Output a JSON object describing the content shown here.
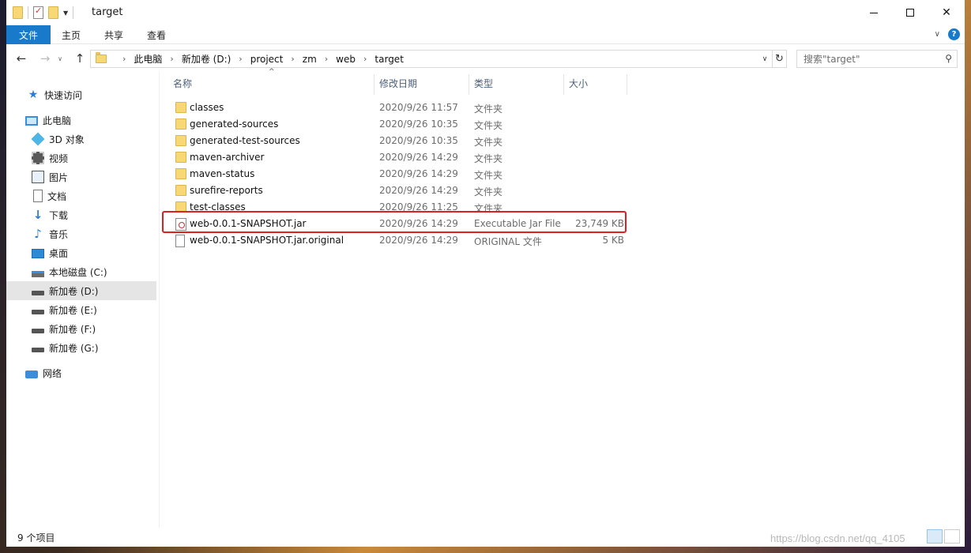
{
  "window": {
    "title": "target"
  },
  "ribbon": {
    "tabs": [
      "文件",
      "主页",
      "共享",
      "查看"
    ]
  },
  "address": {
    "crumbs": [
      "此电脑",
      "新加卷 (D:)",
      "project",
      "zm",
      "web",
      "target"
    ]
  },
  "search": {
    "placeholder": "搜索\"target\""
  },
  "sidebar": {
    "items": [
      {
        "label": "快速访问",
        "icon": "star-icon"
      },
      {
        "label": "此电脑",
        "icon": "computer-icon"
      },
      {
        "label": "3D 对象",
        "icon": "cube-icon"
      },
      {
        "label": "视频",
        "icon": "video-icon"
      },
      {
        "label": "图片",
        "icon": "picture-icon"
      },
      {
        "label": "文档",
        "icon": "document-icon"
      },
      {
        "label": "下载",
        "icon": "download-icon"
      },
      {
        "label": "音乐",
        "icon": "music-icon"
      },
      {
        "label": "桌面",
        "icon": "desktop-icon"
      },
      {
        "label": "本地磁盘 (C:)",
        "icon": "drive-icon"
      },
      {
        "label": "新加卷 (D:)",
        "icon": "drive-icon",
        "selected": true
      },
      {
        "label": "新加卷 (E:)",
        "icon": "drive-icon"
      },
      {
        "label": "新加卷 (F:)",
        "icon": "drive-icon"
      },
      {
        "label": "新加卷 (G:)",
        "icon": "drive-icon"
      },
      {
        "label": "网络",
        "icon": "network-icon"
      }
    ]
  },
  "columns": [
    "名称",
    "修改日期",
    "类型",
    "大小"
  ],
  "files": [
    {
      "name": "classes",
      "date": "2020/9/26 11:57",
      "type": "文件夹",
      "size": "",
      "kind": "folder"
    },
    {
      "name": "generated-sources",
      "date": "2020/9/26 10:35",
      "type": "文件夹",
      "size": "",
      "kind": "folder"
    },
    {
      "name": "generated-test-sources",
      "date": "2020/9/26 10:35",
      "type": "文件夹",
      "size": "",
      "kind": "folder"
    },
    {
      "name": "maven-archiver",
      "date": "2020/9/26 14:29",
      "type": "文件夹",
      "size": "",
      "kind": "folder"
    },
    {
      "name": "maven-status",
      "date": "2020/9/26 14:29",
      "type": "文件夹",
      "size": "",
      "kind": "folder"
    },
    {
      "name": "surefire-reports",
      "date": "2020/9/26 14:29",
      "type": "文件夹",
      "size": "",
      "kind": "folder"
    },
    {
      "name": "test-classes",
      "date": "2020/9/26 11:25",
      "type": "文件夹",
      "size": "",
      "kind": "folder"
    },
    {
      "name": "web-0.0.1-SNAPSHOT.jar",
      "date": "2020/9/26 14:29",
      "type": "Executable Jar File",
      "size": "23,749 KB",
      "kind": "jar"
    },
    {
      "name": "web-0.0.1-SNAPSHOT.jar.original",
      "date": "2020/9/26 14:29",
      "type": "ORIGINAL 文件",
      "size": "5 KB",
      "kind": "file"
    }
  ],
  "status": {
    "count": "9 个项目"
  },
  "watermark": "https://blog.csdn.net/qq_4105",
  "colors": {
    "accent": "#1979ca",
    "highlight_border": "#e02020",
    "folder": "#f8d775"
  }
}
